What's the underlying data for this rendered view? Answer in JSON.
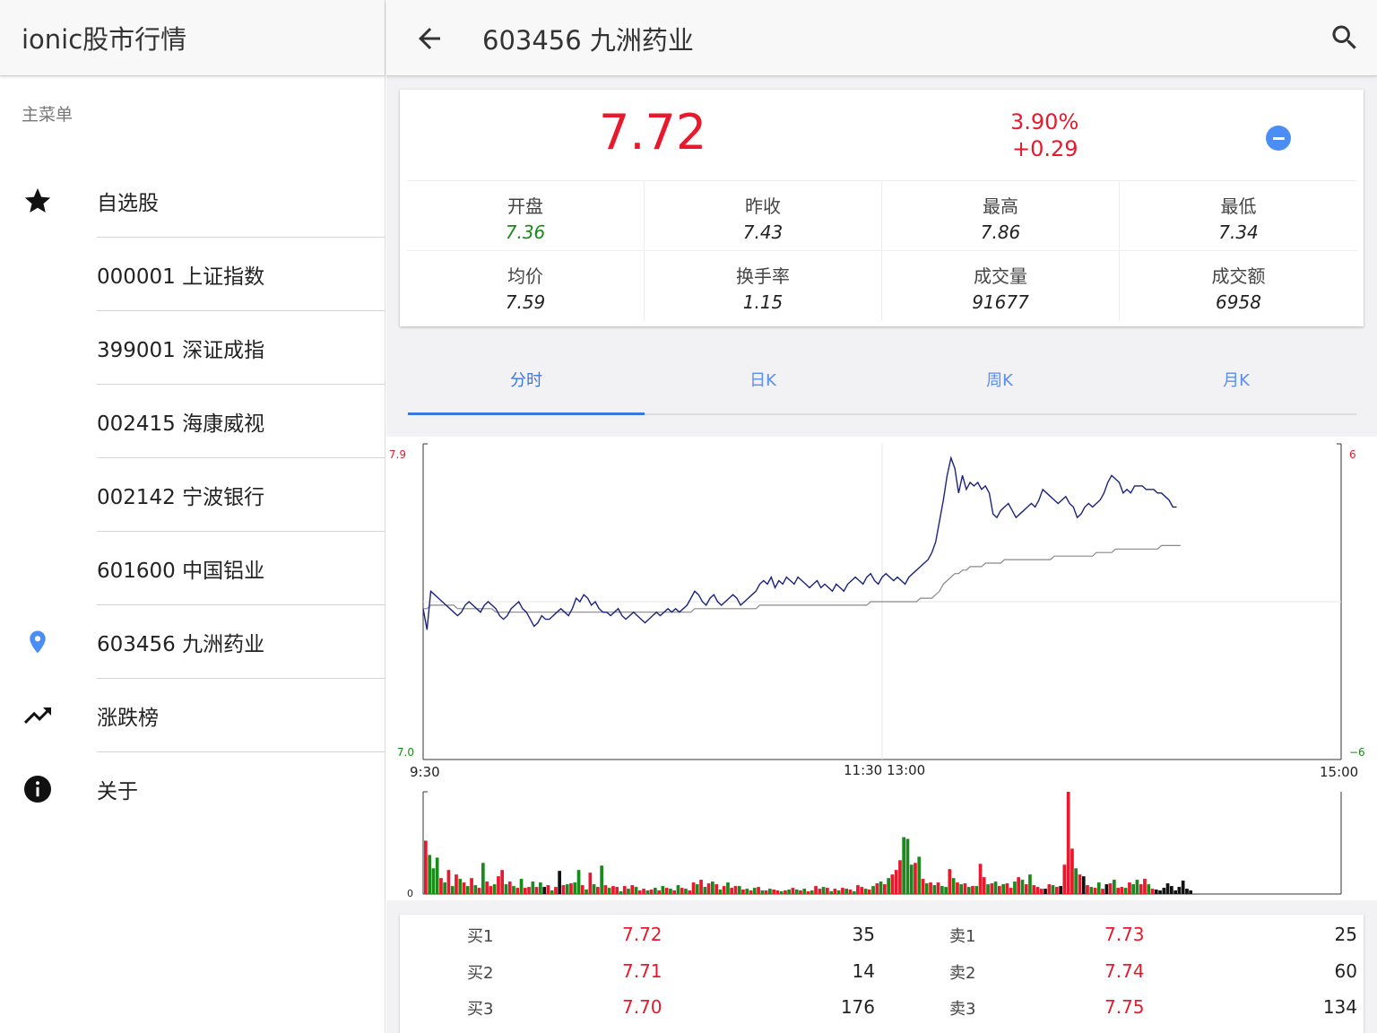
{
  "sidebar": {
    "title": "ionic股市行情",
    "caption": "主菜单",
    "items": [
      {
        "label": "自选股",
        "icon": "star-icon"
      },
      {
        "label": "000001 上证指数",
        "icon": ""
      },
      {
        "label": "399001 深证成指",
        "icon": ""
      },
      {
        "label": "002415 海康威视",
        "icon": ""
      },
      {
        "label": "002142 宁波银行",
        "icon": ""
      },
      {
        "label": "601600 中国铝业",
        "icon": ""
      },
      {
        "label": "603456 九洲药业",
        "icon": "location-pin-icon"
      },
      {
        "label": "涨跌榜",
        "icon": "trending-up-icon"
      },
      {
        "label": "关于",
        "icon": "info-icon"
      }
    ]
  },
  "header": {
    "title": "603456 九洲药业",
    "back_icon": "arrow-back-icon",
    "search_icon": "search-icon"
  },
  "quote": {
    "price": "7.72",
    "change_pct": "3.90%",
    "change_abs": "+0.29",
    "remove_icon": "remove-circle-icon",
    "stats": [
      {
        "key": "开盘",
        "value": "7.36",
        "color": "#1a8a1a"
      },
      {
        "key": "昨收",
        "value": "7.43",
        "color": "#222222"
      },
      {
        "key": "最高",
        "value": "7.86",
        "color": "#222222"
      },
      {
        "key": "最低",
        "value": "7.34",
        "color": "#222222"
      },
      {
        "key": "均价",
        "value": "7.59",
        "color": "#222222"
      },
      {
        "key": "换手率",
        "value": "1.15",
        "color": "#222222"
      },
      {
        "key": "成交量",
        "value": "91677",
        "color": "#222222"
      },
      {
        "key": "成交额",
        "value": "6958",
        "color": "#222222"
      }
    ]
  },
  "tabs": [
    {
      "label": "分时",
      "active": true
    },
    {
      "label": "日K",
      "active": false
    },
    {
      "label": "周K",
      "active": false
    },
    {
      "label": "月K",
      "active": false
    }
  ],
  "colors": {
    "up": "#e8192c",
    "down": "#1a8a1a",
    "line": "#1a237e",
    "avg": "#888888",
    "accent": "#3a78e0"
  },
  "chart_data": {
    "type": "line",
    "x_labels": [
      "9:30",
      "11:30 13:00",
      "15:00"
    ],
    "y_left": [
      "7.9",
      "7.0"
    ],
    "y_right": [
      "6",
      "−6"
    ],
    "volume_axis_label": "0",
    "ylim": [
      7.0,
      7.9
    ],
    "price": [
      7.43,
      7.37,
      7.48,
      7.47,
      7.46,
      7.45,
      7.44,
      7.43,
      7.42,
      7.41,
      7.42,
      7.44,
      7.45,
      7.44,
      7.43,
      7.42,
      7.44,
      7.45,
      7.44,
      7.43,
      7.41,
      7.4,
      7.41,
      7.43,
      7.44,
      7.45,
      7.43,
      7.42,
      7.4,
      7.38,
      7.39,
      7.41,
      7.4,
      7.4,
      7.41,
      7.42,
      7.43,
      7.42,
      7.41,
      7.43,
      7.46,
      7.45,
      7.47,
      7.46,
      7.44,
      7.45,
      7.43,
      7.42,
      7.42,
      7.41,
      7.42,
      7.43,
      7.41,
      7.4,
      7.41,
      7.42,
      7.41,
      7.4,
      7.39,
      7.4,
      7.41,
      7.42,
      7.41,
      7.42,
      7.43,
      7.42,
      7.43,
      7.42,
      7.43,
      7.44,
      7.46,
      7.48,
      7.47,
      7.45,
      7.44,
      7.46,
      7.47,
      7.45,
      7.44,
      7.45,
      7.46,
      7.47,
      7.46,
      7.44,
      7.45,
      7.46,
      7.47,
      7.48,
      7.5,
      7.51,
      7.5,
      7.52,
      7.49,
      7.51,
      7.5,
      7.52,
      7.51,
      7.5,
      7.52,
      7.51,
      7.5,
      7.49,
      7.5,
      7.51,
      7.49,
      7.5,
      7.49,
      7.48,
      7.5,
      7.49,
      7.48,
      7.5,
      7.51,
      7.52,
      7.51,
      7.5,
      7.52,
      7.53,
      7.51,
      7.5,
      7.52,
      7.53,
      7.52,
      7.51,
      7.52,
      7.51,
      7.5,
      7.52,
      7.53,
      7.54,
      7.55,
      7.56,
      7.57,
      7.59,
      7.62,
      7.68,
      7.74,
      7.81,
      7.86,
      7.83,
      7.76,
      7.81,
      7.77,
      7.79,
      7.78,
      7.79,
      7.77,
      7.78,
      7.76,
      7.7,
      7.69,
      7.71,
      7.72,
      7.73,
      7.71,
      7.69,
      7.7,
      7.71,
      7.72,
      7.73,
      7.72,
      7.74,
      7.77,
      7.76,
      7.75,
      7.74,
      7.73,
      7.74,
      7.75,
      7.73,
      7.72,
      7.69,
      7.7,
      7.72,
      7.73,
      7.72,
      7.73,
      7.74,
      7.76,
      7.79,
      7.81,
      7.8,
      7.79,
      7.76,
      7.77,
      7.76,
      7.78,
      7.78,
      7.78,
      7.77,
      7.77,
      7.77,
      7.76,
      7.76,
      7.75,
      7.74,
      7.72,
      7.72
    ],
    "avg": [
      7.43,
      7.43,
      7.44,
      7.44,
      7.44,
      7.44,
      7.44,
      7.44,
      7.44,
      7.43,
      7.43,
      7.43,
      7.43,
      7.43,
      7.43,
      7.43,
      7.43,
      7.43,
      7.43,
      7.42,
      7.42,
      7.42,
      7.42,
      7.42,
      7.42,
      7.42,
      7.42,
      7.42,
      7.42,
      7.42,
      7.42,
      7.42,
      7.42,
      7.42,
      7.42,
      7.42,
      7.42,
      7.42,
      7.42,
      7.42,
      7.42,
      7.42,
      7.42,
      7.42,
      7.42,
      7.42,
      7.42,
      7.42,
      7.42,
      7.42,
      7.42,
      7.42,
      7.42,
      7.42,
      7.42,
      7.42,
      7.42,
      7.42,
      7.42,
      7.42,
      7.42,
      7.42,
      7.42,
      7.42,
      7.42,
      7.42,
      7.42,
      7.42,
      7.42,
      7.42,
      7.42,
      7.43,
      7.43,
      7.43,
      7.43,
      7.43,
      7.43,
      7.43,
      7.43,
      7.43,
      7.43,
      7.43,
      7.43,
      7.43,
      7.43,
      7.43,
      7.43,
      7.43,
      7.44,
      7.44,
      7.44,
      7.44,
      7.44,
      7.44,
      7.44,
      7.44,
      7.44,
      7.44,
      7.44,
      7.44,
      7.44,
      7.44,
      7.44,
      7.44,
      7.44,
      7.44,
      7.44,
      7.44,
      7.44,
      7.44,
      7.44,
      7.44,
      7.44,
      7.44,
      7.44,
      7.44,
      7.44,
      7.45,
      7.45,
      7.45,
      7.45,
      7.45,
      7.45,
      7.45,
      7.45,
      7.45,
      7.45,
      7.45,
      7.45,
      7.45,
      7.46,
      7.46,
      7.46,
      7.46,
      7.47,
      7.48,
      7.5,
      7.51,
      7.52,
      7.53,
      7.53,
      7.54,
      7.54,
      7.55,
      7.55,
      7.55,
      7.55,
      7.56,
      7.56,
      7.56,
      7.56,
      7.56,
      7.57,
      7.57,
      7.57,
      7.57,
      7.57,
      7.57,
      7.57,
      7.57,
      7.57,
      7.57,
      7.57,
      7.57,
      7.57,
      7.58,
      7.58,
      7.58,
      7.58,
      7.58,
      7.58,
      7.58,
      7.58,
      7.58,
      7.58,
      7.58,
      7.59,
      7.59,
      7.59,
      7.59,
      7.59,
      7.6,
      7.6,
      7.6,
      7.6,
      7.6,
      7.6,
      7.6,
      7.6,
      7.6,
      7.6,
      7.6,
      7.6,
      7.61,
      7.61,
      7.61,
      7.61,
      7.61,
      7.61
    ],
    "volume": [
      60,
      44,
      29,
      41,
      18,
      13,
      27,
      9,
      22,
      17,
      13,
      9,
      18,
      10,
      7,
      35,
      14,
      9,
      11,
      20,
      27,
      11,
      14,
      9,
      7,
      17,
      7,
      8,
      14,
      8,
      13,
      8,
      10,
      4,
      8,
      26,
      10,
      11,
      12,
      13,
      27,
      10,
      5,
      24,
      11,
      8,
      32,
      10,
      7,
      9,
      8,
      3,
      9,
      6,
      10,
      8,
      4,
      6,
      4,
      5,
      7,
      4,
      9,
      7,
      6,
      4,
      10,
      7,
      6,
      4,
      13,
      11,
      16,
      8,
      12,
      14,
      11,
      5,
      9,
      13,
      7,
      9,
      9,
      5,
      6,
      4,
      7,
      8,
      4,
      4,
      6,
      5,
      4,
      3,
      4,
      5,
      7,
      5,
      4,
      6,
      3,
      4,
      9,
      6,
      8,
      7,
      3,
      6,
      4,
      7,
      6,
      5,
      3,
      10,
      8,
      6,
      5,
      9,
      12,
      14,
      11,
      18,
      22,
      27,
      38,
      64,
      62,
      33,
      35,
      42,
      17,
      12,
      13,
      10,
      13,
      9,
      8,
      28,
      18,
      13,
      11,
      12,
      8,
      9,
      9,
      34,
      19,
      11,
      12,
      14,
      9,
      11,
      12,
      7,
      14,
      19,
      16,
      11,
      22,
      10,
      8,
      6,
      6,
      11,
      10,
      8,
      9,
      33,
      115,
      51,
      29,
      22,
      20,
      10,
      8,
      7,
      13,
      6,
      11,
      12,
      16,
      7,
      8,
      7,
      13,
      11,
      16,
      11,
      17,
      11,
      6,
      5,
      4,
      7,
      12,
      9,
      4,
      8,
      15,
      6,
      4
    ],
    "volume_colors": [
      "up",
      "down",
      "down",
      "down",
      "up",
      "down",
      "up",
      "down",
      "up",
      "down",
      "up",
      "down",
      "up",
      "down",
      "up",
      "down",
      "up",
      "up",
      "down",
      "up",
      "up",
      "down",
      "up",
      "down",
      "up",
      "down",
      "up",
      "up",
      "down",
      "up",
      "down",
      "black",
      "up",
      "down",
      "up",
      "black",
      "up",
      "down",
      "up",
      "down",
      "down",
      "up",
      "down",
      "up",
      "down",
      "up",
      "down",
      "up",
      "down",
      "up",
      "up",
      "down",
      "up",
      "down",
      "up",
      "down",
      "up",
      "up",
      "down",
      "up",
      "down",
      "up",
      "down",
      "up",
      "down",
      "up",
      "down",
      "up",
      "down",
      "up",
      "up",
      "down",
      "up",
      "down",
      "up",
      "down",
      "up",
      "down",
      "up",
      "down",
      "up",
      "up",
      "down",
      "up",
      "down",
      "up",
      "down",
      "up",
      "down",
      "up",
      "down",
      "up",
      "up",
      "down",
      "up",
      "down",
      "up",
      "down",
      "up",
      "down",
      "up",
      "down",
      "up",
      "up",
      "down",
      "up",
      "down",
      "up",
      "down",
      "up",
      "down",
      "up",
      "down",
      "up",
      "up",
      "down",
      "up",
      "down",
      "up",
      "down",
      "up",
      "down",
      "up",
      "up",
      "up",
      "down",
      "down",
      "down",
      "up",
      "down",
      "up",
      "down",
      "up",
      "down",
      "up",
      "down",
      "down",
      "up",
      "down",
      "up",
      "down",
      "up",
      "down",
      "up",
      "down",
      "up",
      "up",
      "down",
      "up",
      "down",
      "up",
      "down",
      "up",
      "up",
      "down",
      "up",
      "down",
      "up",
      "down",
      "up",
      "up",
      "up",
      "black",
      "up",
      "down",
      "up",
      "black",
      "up",
      "up",
      "up",
      "down",
      "up",
      "black",
      "up",
      "down",
      "up",
      "down",
      "up",
      "black",
      "up",
      "down",
      "up",
      "up",
      "down",
      "up",
      "down",
      "down",
      "up",
      "up",
      "down",
      "up"
    ]
  },
  "orderbook": {
    "bids": [
      {
        "label": "买1",
        "price": "7.72",
        "vol": "35"
      },
      {
        "label": "买2",
        "price": "7.71",
        "vol": "14"
      },
      {
        "label": "买3",
        "price": "7.70",
        "vol": "176"
      }
    ],
    "asks": [
      {
        "label": "卖1",
        "price": "7.73",
        "vol": "25"
      },
      {
        "label": "卖2",
        "price": "7.74",
        "vol": "60"
      },
      {
        "label": "卖3",
        "price": "7.75",
        "vol": "134"
      }
    ]
  }
}
